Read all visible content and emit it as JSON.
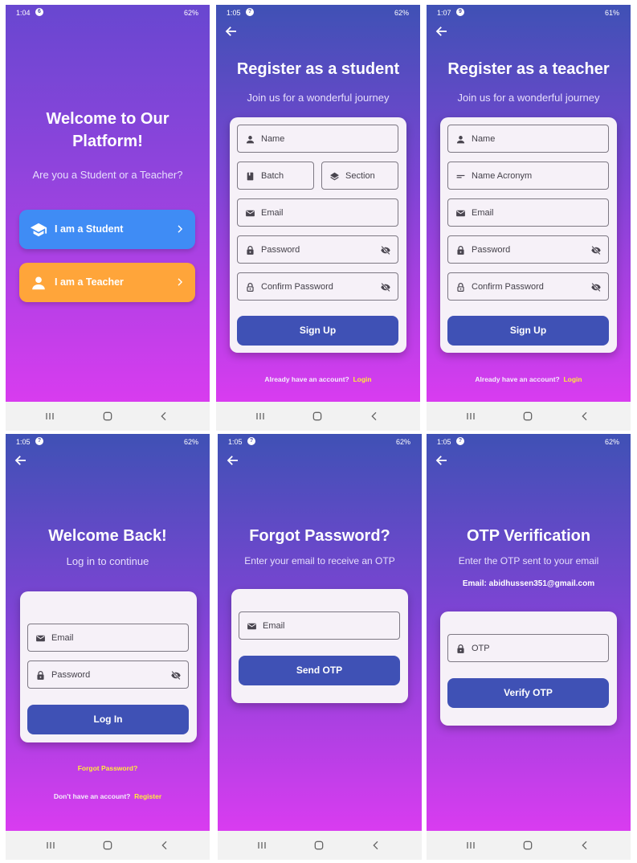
{
  "screens": {
    "role_select": {
      "status": {
        "time": "1:04",
        "sys_badge": "6",
        "right": "62%"
      },
      "title": "Welcome to Our Platform!",
      "subtitle": "Are you a Student or a Teacher?",
      "student_button": "I am a Student",
      "teacher_button": "I am a Teacher"
    },
    "student_register": {
      "status": {
        "time": "1:05",
        "sys_badge": "?",
        "right": "62%"
      },
      "title": "Register as a student",
      "subtitle": "Join us for a wonderful journey",
      "fields": {
        "name": "Name",
        "batch": "Batch",
        "section": "Section",
        "email": "Email",
        "password": "Password",
        "confirm_password": "Confirm Password"
      },
      "signup_button": "Sign Up",
      "footer_text": "Already have an account?",
      "footer_link": "Login"
    },
    "teacher_register": {
      "status": {
        "time": "1:07",
        "sys_badge": "9",
        "right": "61%"
      },
      "title": "Register as a teacher",
      "subtitle": "Join us for a wonderful journey",
      "fields": {
        "name": "Name",
        "name_acronym": "Name Acronym",
        "email": "Email",
        "password": "Password",
        "confirm_password": "Confirm Password"
      },
      "signup_button": "Sign Up",
      "footer_text": "Already have an account?",
      "footer_link": "Login"
    },
    "login": {
      "status": {
        "time": "1:05",
        "sys_badge": "?",
        "right": "62%"
      },
      "title": "Welcome Back!",
      "subtitle": "Log in to continue",
      "fields": {
        "email": "Email",
        "password": "Password"
      },
      "login_button": "Log In",
      "forgot_link": "Forgot Password?",
      "footer_text": "Don't have an account?",
      "footer_link": "Register"
    },
    "forgot_password": {
      "status": {
        "time": "1:05",
        "sys_badge": "?",
        "right": "62%"
      },
      "title": "Forgot Password?",
      "subtitle": "Enter your email to receive an OTP",
      "fields": {
        "email": "Email"
      },
      "send_button": "Send OTP"
    },
    "otp": {
      "status": {
        "time": "1:05",
        "sys_badge": "?",
        "right": "62%"
      },
      "title": "OTP Verification",
      "subtitle": "Enter the OTP sent to your email",
      "email_line": "Email: abidhussen351@gmail.com",
      "fields": {
        "otp": "OTP"
      },
      "verify_button": "Verify OTP"
    }
  },
  "colors": {
    "primary": "#3f51b5",
    "student_button": "#3f8cf5",
    "teacher_button": "#ffa53a",
    "link": "#ffeb3b",
    "gradient_top": "#3f51b5",
    "gradient_bottom": "#d93cf0"
  },
  "icons": [
    "person-icon",
    "book-icon",
    "layers-icon",
    "short-text-icon",
    "mail-icon",
    "lock-icon",
    "lock-outline-icon",
    "eye-off-icon",
    "school-icon",
    "chevron-right-icon",
    "back-arrow-icon"
  ]
}
